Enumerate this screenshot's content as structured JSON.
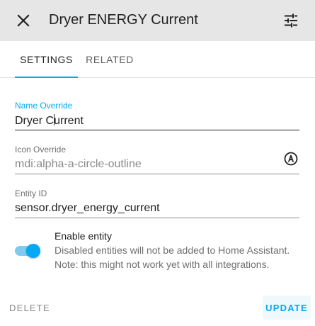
{
  "dialog": {
    "title": "Dryer ENERGY Current"
  },
  "tabs": [
    {
      "label": "SETTINGS",
      "active": true
    },
    {
      "label": "RELATED",
      "active": false
    }
  ],
  "fields": {
    "name_override": {
      "label": "Name Override",
      "value_before_caret": "Dryer C",
      "value_after_caret": "urrent"
    },
    "icon_override": {
      "label": "Icon Override",
      "value": "mdi:alpha-a-circle-outline",
      "icon": "alpha-a-circle-outline-icon"
    },
    "entity_id": {
      "label": "Entity ID",
      "value": "sensor.dryer_energy_current"
    }
  },
  "enable_entity": {
    "enabled": true,
    "title": "Enable entity",
    "description_line1": "Disabled entities will not be added to Home Assistant.",
    "description_line2": "Note: this might not work yet with all integrations."
  },
  "actions": {
    "delete_label": "DELETE",
    "update_label": "UPDATE"
  },
  "colors": {
    "accent": "#03a9f4",
    "header_bg": "#e6e6e6"
  }
}
